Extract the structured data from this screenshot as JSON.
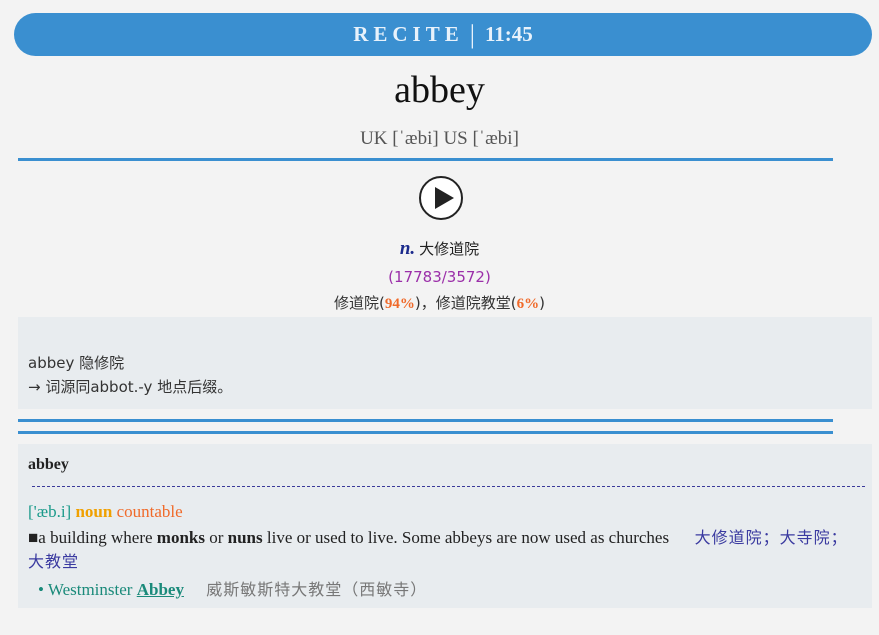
{
  "header": {
    "mode": "RECITE",
    "separator": "|",
    "time": "11:45"
  },
  "word": "abbey",
  "phonetic": "UK [ˈæbi] US [ˈæbi]",
  "definition": {
    "pos": "n.",
    "meaning": "大修道院"
  },
  "frequency": "(17783/3572)",
  "senses": [
    {
      "label": "修道院",
      "pct": "94%"
    },
    {
      "label": "修道院教堂",
      "pct": "6%"
    }
  ],
  "senses_text": {
    "open": "(",
    "close": ")",
    "joiner": "，"
  },
  "etymology": {
    "line1": "abbey 隐修院",
    "line2": "→ 词源同abbot.-y 地点后缀。"
  },
  "dictionary": {
    "headword": "abbey",
    "ipa": "['æb.i]",
    "pos": "noun",
    "countability": "countable",
    "definition_parts": [
      "a building where ",
      "monks",
      " or ",
      "nuns",
      " live or used to live. Some abbeys are now used as churches"
    ],
    "bullet": "■",
    "definition_zh": "大修道院；大寺院；大教堂",
    "example": {
      "prefix": "• Westminster ",
      "keyword": "Abbey",
      "translation": "威斯敏斯特大教堂（西敏寺）"
    }
  },
  "colors": {
    "accent": "#3a8fd0",
    "pos": "#1b2a8c",
    "freq": "#9b2fa9",
    "pct": "#f06a2a",
    "noun": "#f0a000",
    "ipa": "#1a9a8a"
  },
  "icons": {
    "play": "play-icon"
  }
}
